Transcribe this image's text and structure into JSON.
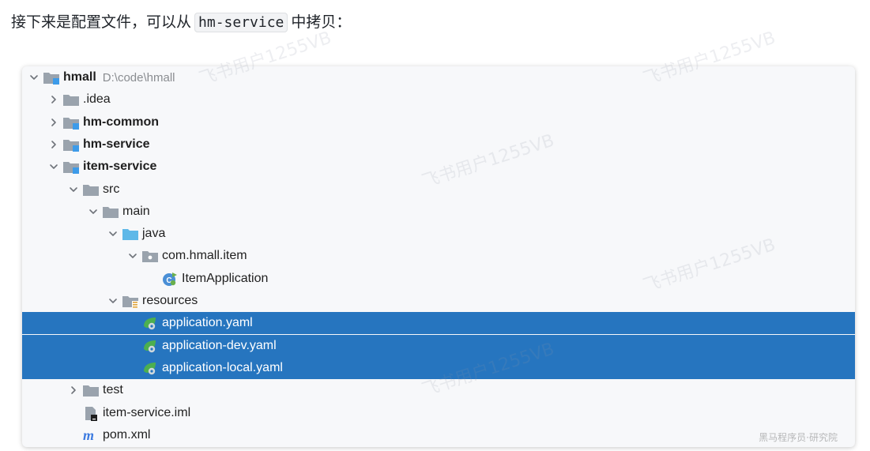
{
  "intro": {
    "text_before": "接下来是配置文件，可以从",
    "code": "hm-service",
    "text_after": "中拷贝："
  },
  "tree": [
    {
      "label": "hmall",
      "path": "D:\\code\\hmall",
      "icon": "module-folder-icon",
      "arrow": "down",
      "bold": true
    },
    {
      "label": ".idea",
      "icon": "folder-icon",
      "arrow": "right"
    },
    {
      "label": "hm-common",
      "icon": "module-folder-icon",
      "arrow": "right",
      "bold": true
    },
    {
      "label": "hm-service",
      "icon": "module-folder-icon",
      "arrow": "right",
      "bold": true
    },
    {
      "label": "item-service",
      "icon": "module-folder-icon",
      "arrow": "down",
      "bold": true
    },
    {
      "label": "src",
      "icon": "folder-icon",
      "arrow": "down"
    },
    {
      "label": "main",
      "icon": "folder-icon",
      "arrow": "down"
    },
    {
      "label": "java",
      "icon": "source-folder-icon",
      "arrow": "down"
    },
    {
      "label": "com.hmall.item",
      "icon": "package-icon",
      "arrow": "down"
    },
    {
      "label": "ItemApplication",
      "icon": "spring-class-icon"
    },
    {
      "label": "resources",
      "icon": "resources-folder-icon",
      "arrow": "down"
    },
    {
      "label": "application.yaml",
      "icon": "spring-config-icon",
      "selected": true
    },
    {
      "label": "application-dev.yaml",
      "icon": "spring-config-icon",
      "selected": true
    },
    {
      "label": "application-local.yaml",
      "icon": "spring-config-icon",
      "selected": true
    },
    {
      "label": "test",
      "icon": "folder-icon",
      "arrow": "right"
    },
    {
      "label": "item-service.iml",
      "icon": "iml-file-icon"
    },
    {
      "label": "pom.xml",
      "icon": "maven-icon"
    }
  ],
  "watermark": "飞书用户1255VB",
  "corner_mark": "黑马程序员·研究院",
  "colors": {
    "selection": "#2675bf",
    "folder": "#9aa3ad",
    "module_badge": "#3d9be9"
  }
}
